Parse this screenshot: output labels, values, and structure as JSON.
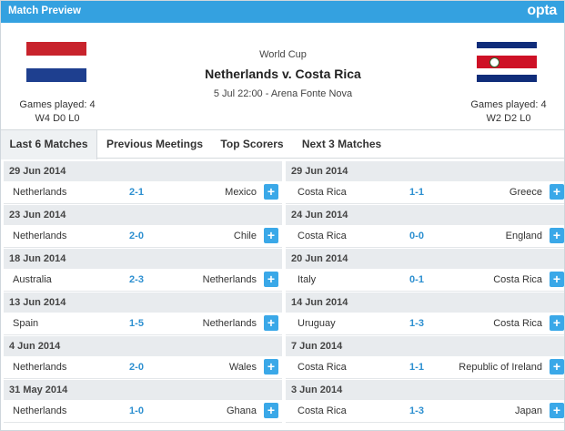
{
  "header": {
    "title": "Match Preview",
    "logo": "opta"
  },
  "match": {
    "competition": "World Cup",
    "teams": "Netherlands v. Costa Rica",
    "date_venue": "5 Jul 22:00 - Arena Fonte Nova",
    "home": {
      "games_played": "Games played: 4",
      "record": "W4 D0 L0",
      "flag": "netherlands-flag"
    },
    "away": {
      "games_played": "Games played: 4",
      "record": "W2 D2 L0",
      "flag": "costa-rica-flag"
    }
  },
  "tabs": [
    {
      "label": "Last 6 Matches",
      "active": true
    },
    {
      "label": "Previous Meetings",
      "active": false
    },
    {
      "label": "Top Scorers",
      "active": false
    },
    {
      "label": "Next 3 Matches",
      "active": false
    }
  ],
  "left_matches": [
    {
      "date": "29 Jun 2014",
      "home": "Netherlands",
      "score": "2-1",
      "away": "Mexico",
      "button": "+"
    },
    {
      "date": "23 Jun 2014",
      "home": "Netherlands",
      "score": "2-0",
      "away": "Chile",
      "button": "+"
    },
    {
      "date": "18 Jun 2014",
      "home": "Australia",
      "score": "2-3",
      "away": "Netherlands",
      "button": "+"
    },
    {
      "date": "13 Jun 2014",
      "home": "Spain",
      "score": "1-5",
      "away": "Netherlands",
      "button": "+"
    },
    {
      "date": "4 Jun 2014",
      "home": "Netherlands",
      "score": "2-0",
      "away": "Wales",
      "button": "+"
    },
    {
      "date": "31 May 2014",
      "home": "Netherlands",
      "score": "1-0",
      "away": "Ghana",
      "button": "+"
    }
  ],
  "right_matches": [
    {
      "date": "29 Jun 2014",
      "home": "Costa Rica",
      "score": "1-1",
      "away": "Greece",
      "button": "+"
    },
    {
      "date": "24 Jun 2014",
      "home": "Costa Rica",
      "score": "0-0",
      "away": "England",
      "button": "+"
    },
    {
      "date": "20 Jun 2014",
      "home": "Italy",
      "score": "0-1",
      "away": "Costa Rica",
      "button": "+"
    },
    {
      "date": "14 Jun 2014",
      "home": "Uruguay",
      "score": "1-3",
      "away": "Costa Rica",
      "button": "+"
    },
    {
      "date": "7 Jun 2014",
      "home": "Costa Rica",
      "score": "1-1",
      "away": "Republic of Ireland",
      "button": "+"
    },
    {
      "date": "3 Jun 2014",
      "home": "Costa Rica",
      "score": "1-3",
      "away": "Japan",
      "button": "+"
    }
  ],
  "colors": {
    "accent": "#34a1e0",
    "score": "#2c8fd0",
    "button": "#3aa8e8",
    "date_bg": "#e8ebee"
  }
}
